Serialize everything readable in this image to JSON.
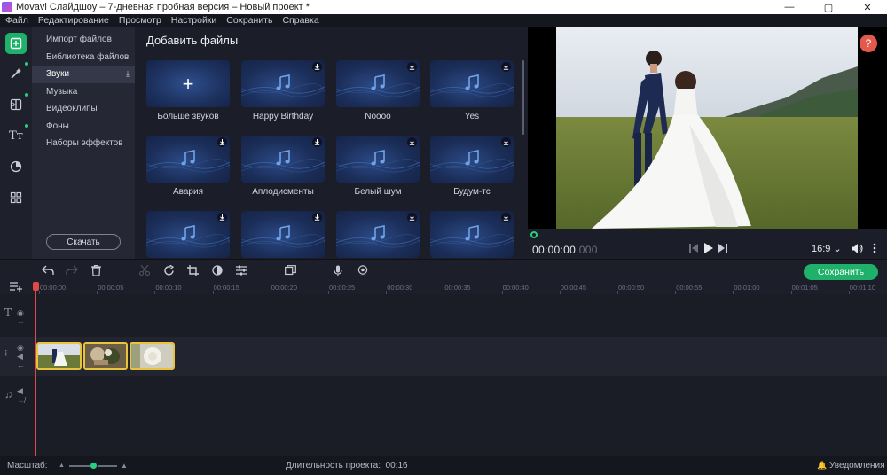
{
  "window": {
    "title": "Movavi Слайдшоу – 7-дневная пробная версия – Новый проект *",
    "minimize": "—",
    "maximize": "▢",
    "close": "✕"
  },
  "menu": [
    "Файл",
    "Редактирование",
    "Просмотр",
    "Настройки",
    "Сохранить",
    "Справка"
  ],
  "rail": {
    "items": [
      {
        "name": "import",
        "icon": "add-media-icon",
        "active": true
      },
      {
        "name": "magic",
        "icon": "magic-wand-icon",
        "dot": true
      },
      {
        "name": "transitions",
        "icon": "transition-icon",
        "dot": true
      },
      {
        "name": "titles",
        "icon": "text-tt-icon",
        "label": "Tт",
        "dot": true
      },
      {
        "name": "filters",
        "icon": "filter-circle-icon"
      },
      {
        "name": "more",
        "icon": "grid-icon"
      }
    ]
  },
  "categories": {
    "items": [
      "Импорт файлов",
      "Библиотека файлов",
      "Звуки",
      "Музыка",
      "Видеоклипы",
      "Фоны",
      "Наборы эффектов"
    ],
    "selected": "Звуки",
    "download_button": "Скачать"
  },
  "files": {
    "heading": "Добавить файлы",
    "tiles": [
      {
        "label": "Больше звуков",
        "type": "add"
      },
      {
        "label": "Happy Birthday",
        "type": "sound"
      },
      {
        "label": "Noooo",
        "type": "sound"
      },
      {
        "label": "Yes",
        "type": "sound"
      },
      {
        "label": "Авария",
        "type": "sound"
      },
      {
        "label": "Аплодисменты",
        "type": "sound"
      },
      {
        "label": "Белый шум",
        "type": "sound"
      },
      {
        "label": "Будум-тс",
        "type": "sound"
      },
      {
        "label": "",
        "type": "sound"
      },
      {
        "label": "",
        "type": "sound"
      },
      {
        "label": "",
        "type": "sound"
      },
      {
        "label": "",
        "type": "sound"
      }
    ]
  },
  "preview": {
    "help": "?",
    "time_main": "00:00:00",
    "time_ms": ".000",
    "aspect_ratio": "16:9 ⌄"
  },
  "toolbar": {
    "save_button": "Сохранить"
  },
  "ruler": {
    "ticks": [
      "00:00:00",
      "00:00:05",
      "00:00:10",
      "00:00:15",
      "00:00:20",
      "00:00:25",
      "00:00:30",
      "00:00:35",
      "00:00:40",
      "00:00:45",
      "00:00:50",
      "00:00:55",
      "00:01:00",
      "00:01:05",
      "00:01:10"
    ]
  },
  "clips": [
    {
      "name": "wedding-couple-photo"
    },
    {
      "name": "rings-bouquet-photo"
    },
    {
      "name": "white-roses-photo"
    }
  ],
  "status": {
    "scale_label": "Масштаб:",
    "zoom_level": 0.5,
    "duration_label": "Длительность проекта:",
    "duration_value": "00:16",
    "notifications": "Уведомления"
  },
  "colors": {
    "accent": "#1fb16a",
    "playhead": "#e0484a",
    "clip_border": "#e8c43c",
    "help": "#e35a4d"
  }
}
